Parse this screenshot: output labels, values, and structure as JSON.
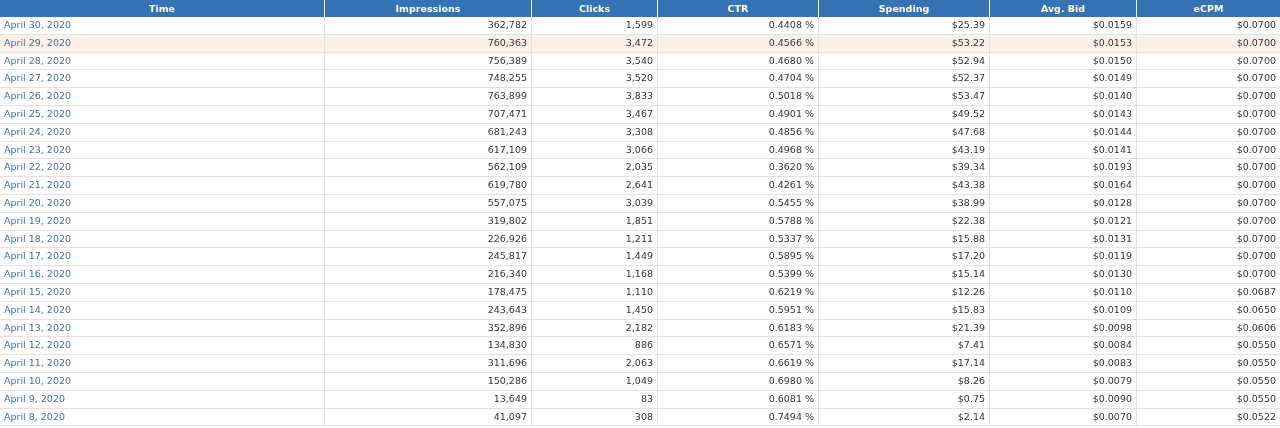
{
  "table": {
    "columns": [
      "Time",
      "Impressions",
      "Clicks",
      "CTR",
      "Spending",
      "Avg. Bid",
      "eCPM"
    ],
    "rows": [
      {
        "cells": [
          "April 30, 2020",
          "362,782",
          "1,599",
          "0.4408 %",
          "$25.39",
          "$0.0159",
          "$0.0700"
        ],
        "highlighted": false
      },
      {
        "cells": [
          "April 29, 2020",
          "760,363",
          "3,472",
          "0.4566 %",
          "$53.22",
          "$0.0153",
          "$0.0700"
        ],
        "highlighted": true
      },
      {
        "cells": [
          "April 28, 2020",
          "756,389",
          "3,540",
          "0.4680 %",
          "$52.94",
          "$0.0150",
          "$0.0700"
        ],
        "highlighted": false
      },
      {
        "cells": [
          "April 27, 2020",
          "748,255",
          "3,520",
          "0.4704 %",
          "$52.37",
          "$0.0149",
          "$0.0700"
        ],
        "highlighted": false
      },
      {
        "cells": [
          "April 26, 2020",
          "763,899",
          "3,833",
          "0.5018 %",
          "$53.47",
          "$0.0140",
          "$0.0700"
        ],
        "highlighted": false
      },
      {
        "cells": [
          "April 25, 2020",
          "707,471",
          "3,467",
          "0.4901 %",
          "$49.52",
          "$0.0143",
          "$0.0700"
        ],
        "highlighted": false
      },
      {
        "cells": [
          "April 24, 2020",
          "681,243",
          "3,308",
          "0.4856 %",
          "$47.68",
          "$0.0144",
          "$0.0700"
        ],
        "highlighted": false
      },
      {
        "cells": [
          "April 23, 2020",
          "617,109",
          "3,066",
          "0.4968 %",
          "$43.19",
          "$0.0141",
          "$0.0700"
        ],
        "highlighted": false
      },
      {
        "cells": [
          "April 22, 2020",
          "562,109",
          "2,035",
          "0.3620 %",
          "$39.34",
          "$0.0193",
          "$0.0700"
        ],
        "highlighted": false
      },
      {
        "cells": [
          "April 21, 2020",
          "619,780",
          "2,641",
          "0.4261 %",
          "$43.38",
          "$0.0164",
          "$0.0700"
        ],
        "highlighted": false
      },
      {
        "cells": [
          "April 20, 2020",
          "557,075",
          "3,039",
          "0.5455 %",
          "$38.99",
          "$0.0128",
          "$0.0700"
        ],
        "highlighted": false
      },
      {
        "cells": [
          "April 19, 2020",
          "319,802",
          "1,851",
          "0.5788 %",
          "$22.38",
          "$0.0121",
          "$0.0700"
        ],
        "highlighted": false
      },
      {
        "cells": [
          "April 18, 2020",
          "226,926",
          "1,211",
          "0.5337 %",
          "$15.88",
          "$0.0131",
          "$0.0700"
        ],
        "highlighted": false
      },
      {
        "cells": [
          "April 17, 2020",
          "245,817",
          "1,449",
          "0.5895 %",
          "$17.20",
          "$0.0119",
          "$0.0700"
        ],
        "highlighted": false
      },
      {
        "cells": [
          "April 16, 2020",
          "216,340",
          "1,168",
          "0.5399 %",
          "$15.14",
          "$0.0130",
          "$0.0700"
        ],
        "highlighted": false
      },
      {
        "cells": [
          "April 15, 2020",
          "178,475",
          "1,110",
          "0.6219 %",
          "$12.26",
          "$0.0110",
          "$0.0687"
        ],
        "highlighted": false
      },
      {
        "cells": [
          "April 14, 2020",
          "243,643",
          "1,450",
          "0.5951 %",
          "$15.83",
          "$0.0109",
          "$0.0650"
        ],
        "highlighted": false
      },
      {
        "cells": [
          "April 13, 2020",
          "352,896",
          "2,182",
          "0.6183 %",
          "$21.39",
          "$0.0098",
          "$0.0606"
        ],
        "highlighted": false
      },
      {
        "cells": [
          "April 12, 2020",
          "134,830",
          "886",
          "0.6571 %",
          "$7.41",
          "$0.0084",
          "$0.0550"
        ],
        "highlighted": false
      },
      {
        "cells": [
          "April 11, 2020",
          "311,696",
          "2,063",
          "0.6619 %",
          "$17.14",
          "$0.0083",
          "$0.0550"
        ],
        "highlighted": false
      },
      {
        "cells": [
          "April 10, 2020",
          "150,286",
          "1,049",
          "0.6980 %",
          "$8.26",
          "$0.0079",
          "$0.0550"
        ],
        "highlighted": false
      },
      {
        "cells": [
          "April 9, 2020",
          "13,649",
          "83",
          "0.6081 %",
          "$0.75",
          "$0.0090",
          "$0.0550"
        ],
        "highlighted": false
      },
      {
        "cells": [
          "April 8, 2020",
          "41,097",
          "308",
          "0.7494 %",
          "$2.14",
          "$0.0070",
          "$0.0522"
        ],
        "highlighted": false
      }
    ]
  }
}
